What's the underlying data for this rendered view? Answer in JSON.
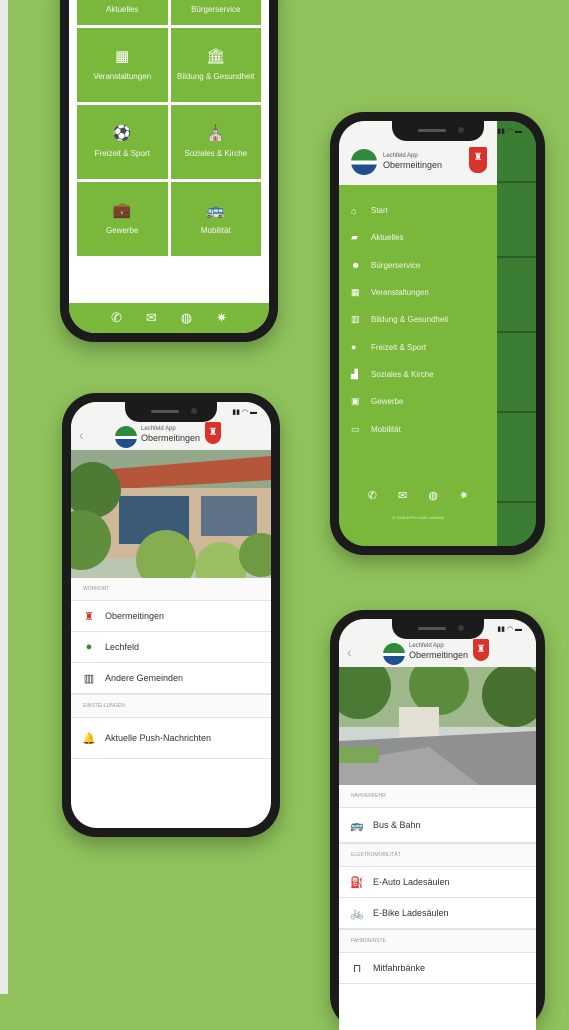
{
  "background": {
    "color": "#8fc25b",
    "accent_green": "#7ab83c"
  },
  "phone1": {
    "tiles": [
      {
        "icon": "",
        "label": "Aktuelles"
      },
      {
        "icon": "",
        "label": "Bürgerservice"
      },
      {
        "icon": "calendar-icon",
        "label": "Veranstaltungen"
      },
      {
        "icon": "building-icon",
        "label": "Bildung & Gesundheit"
      },
      {
        "icon": "soccer-ball-icon",
        "label": "Freizeit & Sport"
      },
      {
        "icon": "church-icon",
        "label": "Soziales & Kirche"
      },
      {
        "icon": "briefcase-icon",
        "label": "Gewerbe"
      },
      {
        "icon": "bus-icon",
        "label": "Mobilität"
      }
    ],
    "bottom_bar": [
      "phone-icon",
      "mail-icon",
      "globe-icon",
      "gear-icon"
    ]
  },
  "phone2": {
    "logo_small": "Lechfeld App",
    "logo_big": "Obermeitingen",
    "menu": [
      {
        "icon": "home-icon",
        "label": "Start"
      },
      {
        "icon": "chat-icon",
        "label": "Aktuelles"
      },
      {
        "icon": "people-icon",
        "label": "Bürgerservice"
      },
      {
        "icon": "calendar-icon",
        "label": "Veranstaltungen"
      },
      {
        "icon": "building-icon",
        "label": "Bildung & Gesundheit"
      },
      {
        "icon": "soccer-ball-icon",
        "label": "Freizeit & Sport"
      },
      {
        "icon": "church-icon",
        "label": "Soziales & Kirche"
      },
      {
        "icon": "briefcase-icon",
        "label": "Gewerbe"
      },
      {
        "icon": "bus-icon",
        "label": "Mobilität"
      }
    ],
    "copyright": "© 2023 APPYLAND Lechfeld"
  },
  "phone3": {
    "logo_small": "Lechfeld App",
    "logo_big": "Obermeitingen",
    "section1": "WOHNORT",
    "items1": [
      {
        "icon": "crest-icon",
        "label": "Obermeitingen"
      },
      {
        "icon": "lechfeld-logo-icon",
        "label": "Lechfeld"
      },
      {
        "icon": "community-icon",
        "label": "Andere Gemeinden"
      }
    ],
    "section2": "EINSTELLUNGEN",
    "items2": [
      {
        "icon": "bell-icon",
        "label": "Aktuelle Push-Nachrichten"
      }
    ]
  },
  "phone4": {
    "logo_small": "Lechfeld App",
    "logo_big": "Obermeitingen",
    "section1": "NAHVERKEHR",
    "items1": [
      {
        "icon": "bus-icon",
        "label": "Bus & Bahn"
      }
    ],
    "section2": "ELEKTROMOBILITÄT",
    "items2": [
      {
        "icon": "charging-station-icon",
        "label": "E-Auto Ladesäulen"
      },
      {
        "icon": "ebike-icon",
        "label": "E-Bike Ladesäulen"
      }
    ],
    "section3": "FAHRDIENSTE",
    "items3": [
      {
        "icon": "bench-icon",
        "label": "Mitfahrbänke"
      }
    ]
  }
}
